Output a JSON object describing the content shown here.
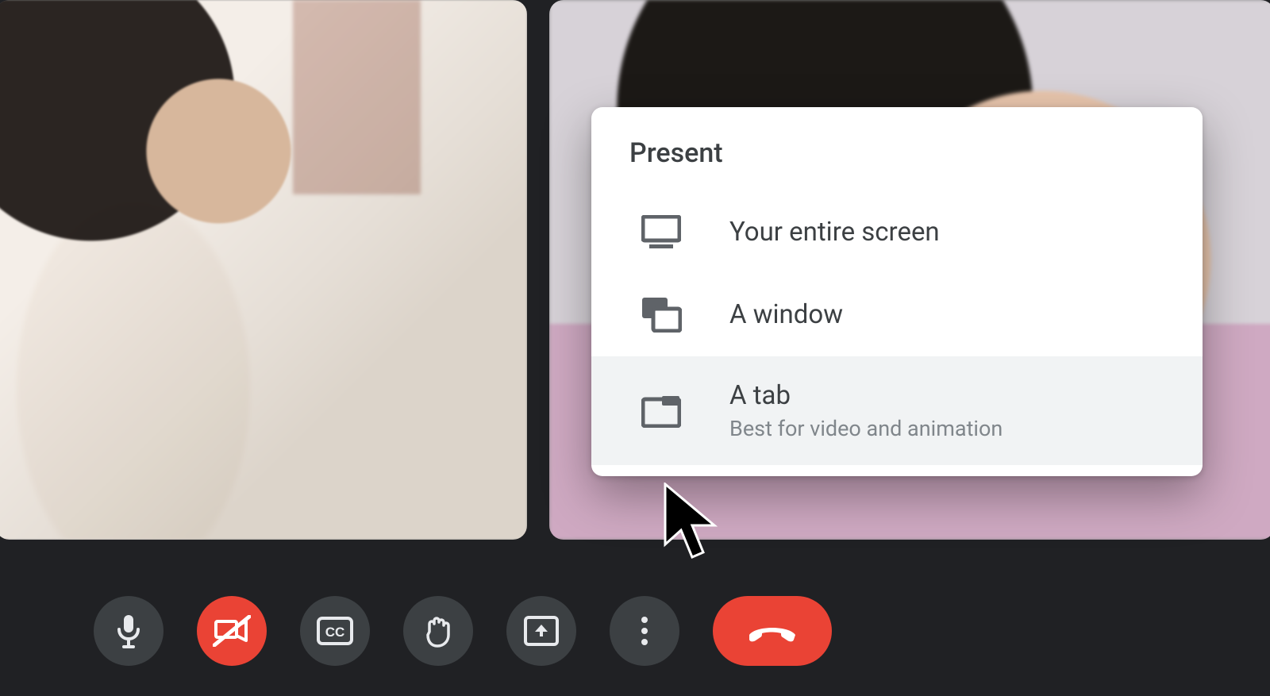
{
  "present": {
    "title": "Present",
    "options": [
      {
        "icon": "monitor-icon",
        "label": "Your entire screen",
        "sublabel": ""
      },
      {
        "icon": "window-icon",
        "label": "A window",
        "sublabel": ""
      },
      {
        "icon": "tab-icon",
        "label": "A tab",
        "sublabel": "Best for video and animation"
      }
    ],
    "hover_index": 2
  },
  "toolbar": {
    "buttons": [
      {
        "name": "mic-button",
        "icon": "mic-icon",
        "style": "normal"
      },
      {
        "name": "camera-button",
        "icon": "camera-off-icon",
        "style": "red"
      },
      {
        "name": "captions-button",
        "icon": "cc-icon",
        "style": "normal"
      },
      {
        "name": "raise-hand-button",
        "icon": "hand-icon",
        "style": "normal"
      },
      {
        "name": "present-button",
        "icon": "present-icon",
        "style": "normal"
      },
      {
        "name": "more-options-button",
        "icon": "more-icon",
        "style": "normal"
      },
      {
        "name": "leave-call-button",
        "icon": "hangup-icon",
        "style": "red-pill"
      }
    ]
  }
}
